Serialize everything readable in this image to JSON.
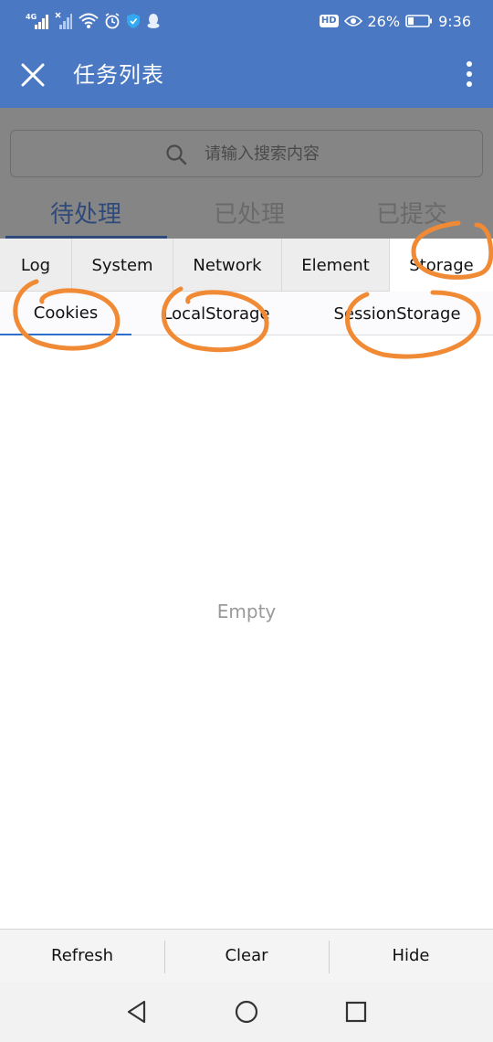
{
  "status_bar": {
    "network_label": "4G",
    "battery_percent": "26%",
    "time": "9:36",
    "hd_badge": "HD"
  },
  "header": {
    "title": "任务列表",
    "icons": [
      "close-icon",
      "more-vert-icon"
    ]
  },
  "background_page": {
    "search_placeholder": "请输入搜索内容",
    "tabs": [
      {
        "label": "待处理",
        "active": true
      },
      {
        "label": "已处理",
        "active": false
      },
      {
        "label": "已提交",
        "active": false
      }
    ]
  },
  "console": {
    "tabs": [
      {
        "label": "Log",
        "active": false
      },
      {
        "label": "System",
        "active": false
      },
      {
        "label": "Network",
        "active": false
      },
      {
        "label": "Element",
        "active": false
      },
      {
        "label": "Storage",
        "active": true
      }
    ],
    "subtabs": [
      {
        "label": "Cookies",
        "active": true
      },
      {
        "label": "LocalStorage",
        "active": false
      },
      {
        "label": "SessionStorage",
        "active": false
      }
    ],
    "empty_text": "Empty",
    "toolbar": {
      "refresh": "Refresh",
      "clear": "Clear",
      "hide": "Hide"
    }
  },
  "nav_bar": {
    "icons": [
      "back-icon",
      "home-icon",
      "recents-icon"
    ]
  },
  "colors": {
    "header_blue": "#4a78c2",
    "annotation_orange": "#f08a35",
    "active_underline": "#2f4a7a"
  }
}
